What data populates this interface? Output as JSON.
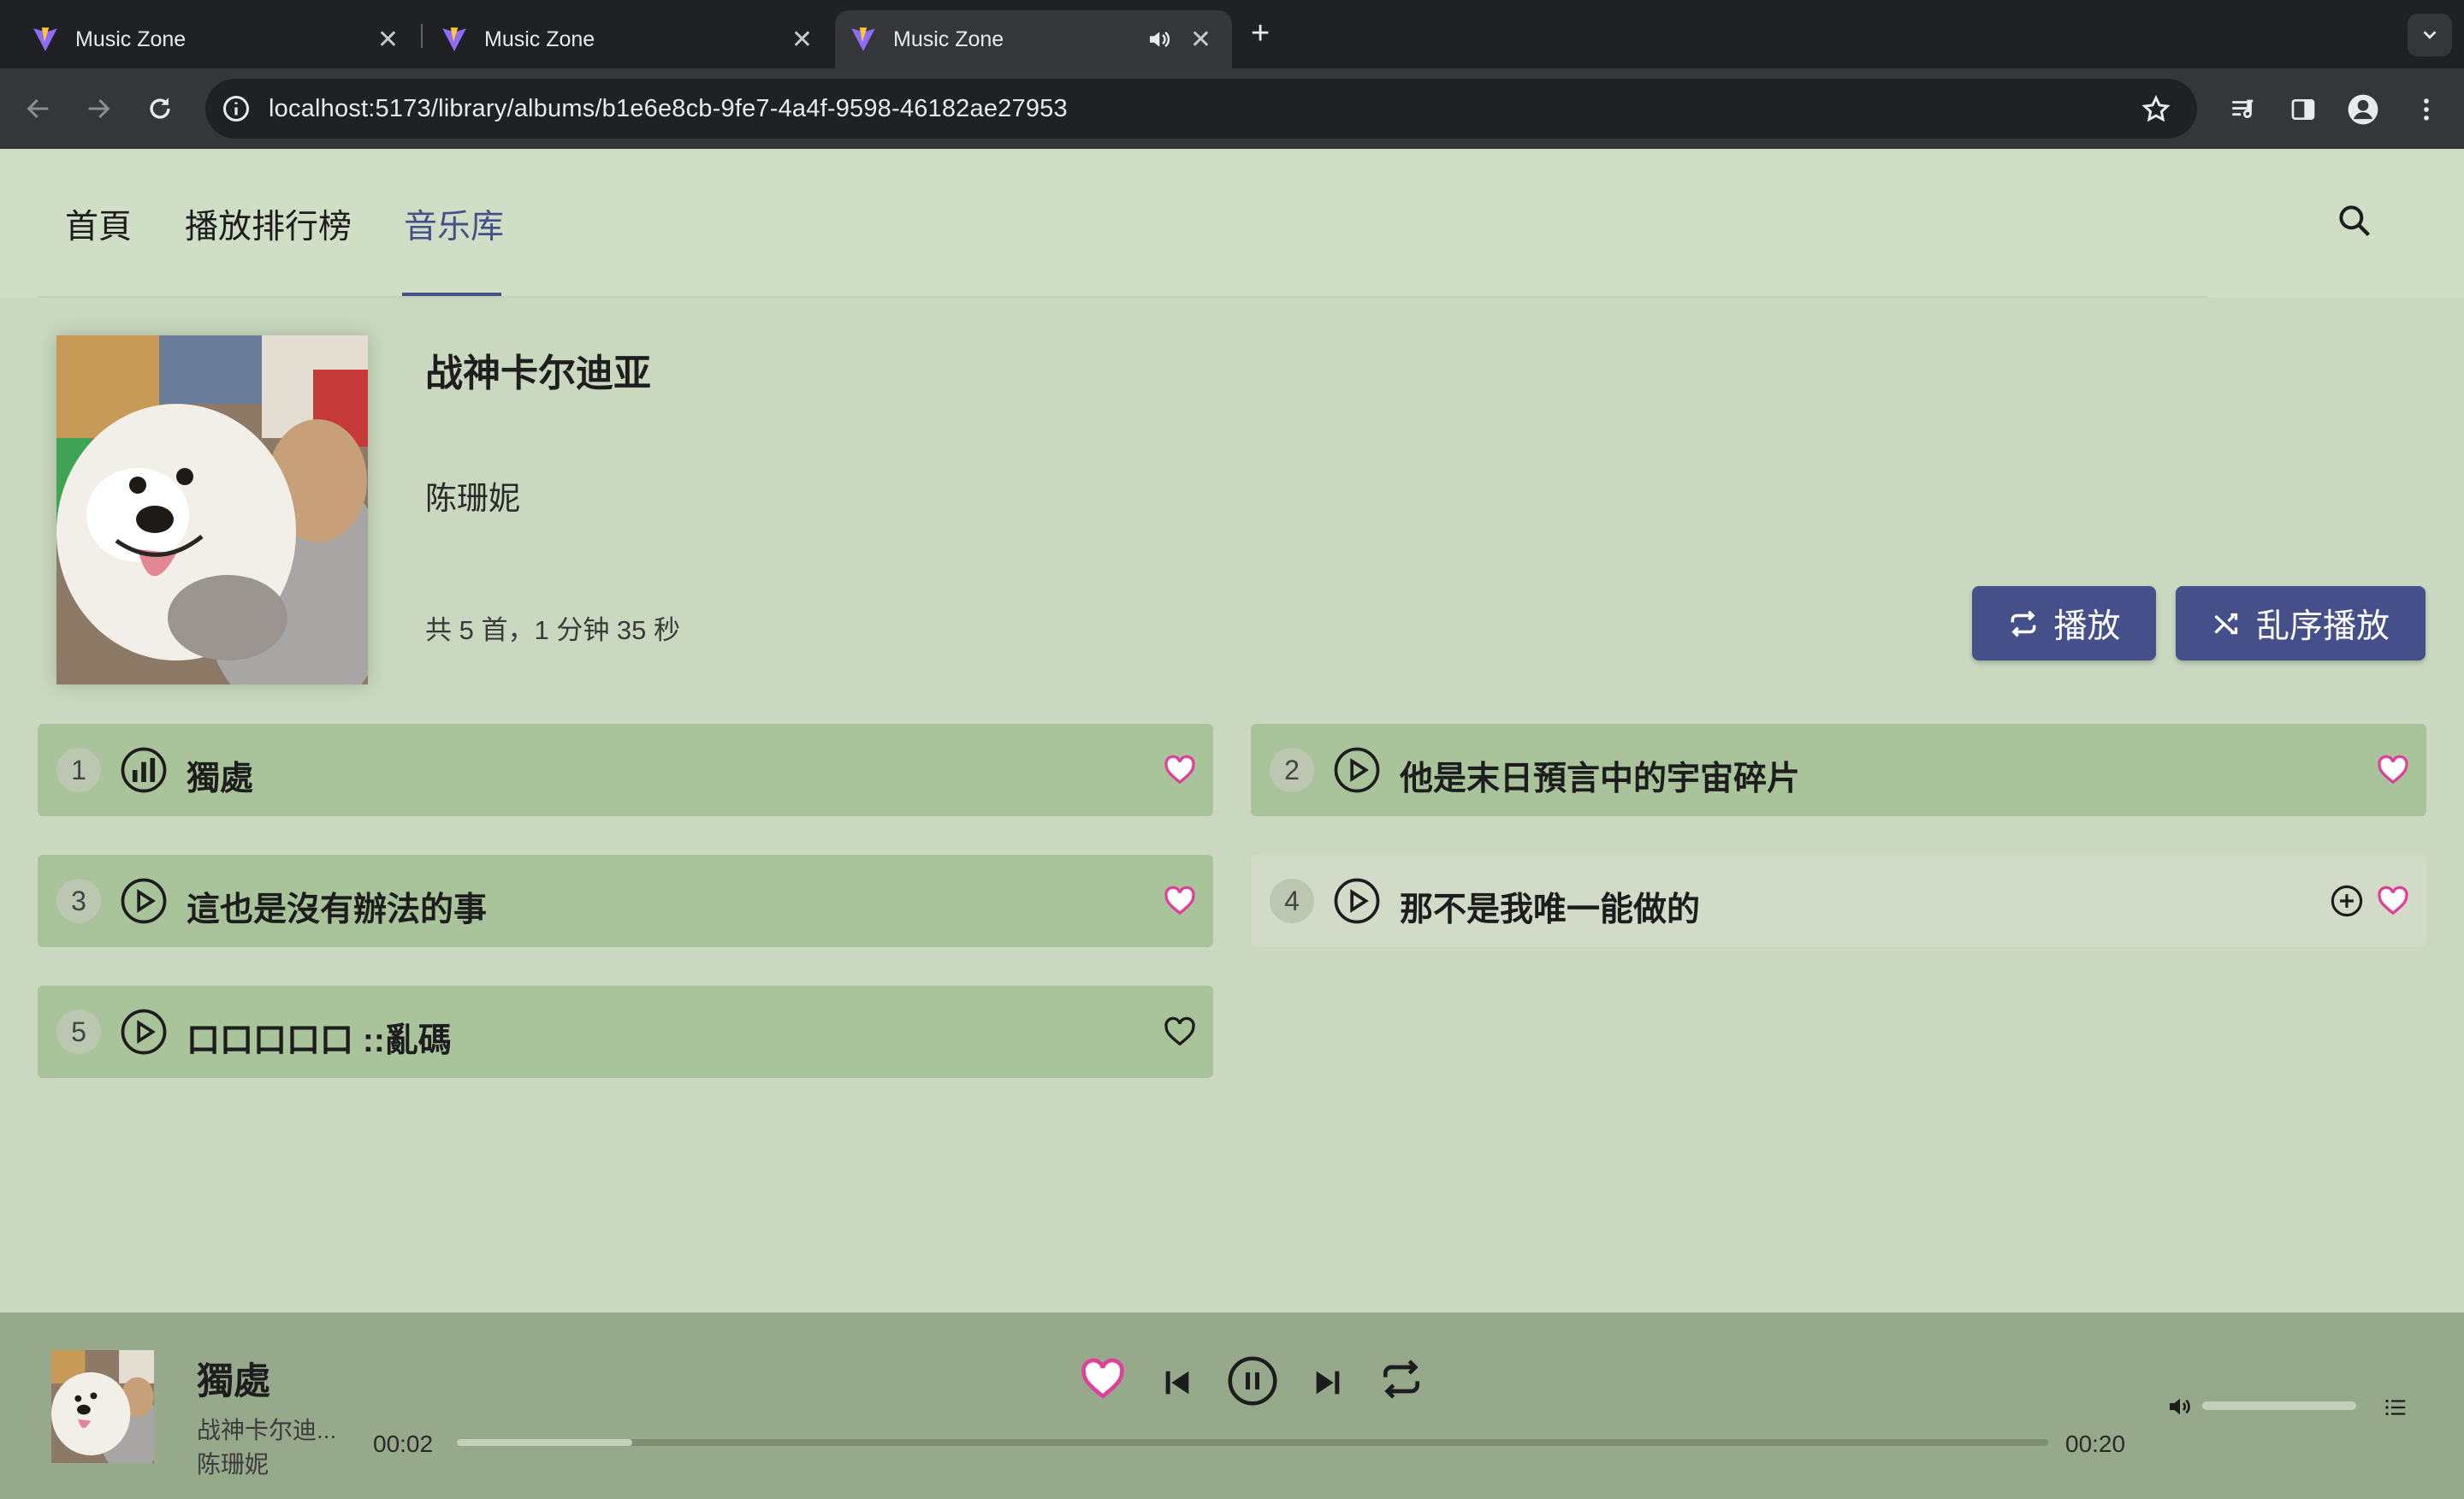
{
  "browser": {
    "tabs": [
      {
        "title": "Music Zone",
        "active": false
      },
      {
        "title": "Music Zone",
        "active": false
      },
      {
        "title": "Music Zone",
        "active": true,
        "audio": true
      }
    ],
    "url": "localhost:5173/library/albums/b1e6e8cb-9fe7-4a4f-9598-46182ae27953"
  },
  "nav": {
    "tabs": [
      "首頁",
      "播放排行榜",
      "音乐库"
    ],
    "active_tab": "音乐库"
  },
  "album": {
    "title": "战神卡尔迪亚",
    "artist": "陈珊妮",
    "meta": "共 5 首，1 分钟 35 秒",
    "play_label": "播放",
    "shuffle_label": "乱序播放"
  },
  "tracks": [
    {
      "num": "1",
      "name": "獨處",
      "state": "playing",
      "favorite": true
    },
    {
      "num": "2",
      "name": "他是末日預言中的宇宙碎片",
      "state": "play",
      "favorite": true
    },
    {
      "num": "3",
      "name": "這也是沒有辦法的事",
      "state": "play",
      "favorite": true
    },
    {
      "num": "4",
      "name": "那不是我唯一能做的",
      "state": "play",
      "favorite": true
    },
    {
      "num": "5",
      "name": "口口口口口 ::亂碼",
      "state": "play",
      "favorite": false
    }
  ],
  "player": {
    "title": "獨處",
    "album": "战神卡尔迪...",
    "artist": "陈珊妮",
    "elapsed": "00:02",
    "duration": "00:20",
    "progress": 0.11,
    "volume": 1.0,
    "favorite": true,
    "playing": true
  },
  "colors": {
    "accent": "#45508a",
    "favorite": "#e0409a",
    "track_bg": "#a9c39b",
    "page_bg": "#c9d8bf"
  }
}
